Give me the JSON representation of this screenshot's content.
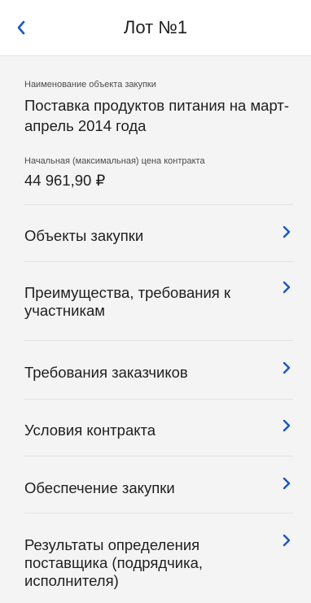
{
  "header": {
    "back_icon": "chevron-left-icon",
    "title": "Лот №1"
  },
  "info": {
    "object_label": "Наименование объекта закупки",
    "object_value": "Поставка продуктов питания на март-апрель 2014 года",
    "price_label": "Начальная (максимальная) цена контракта",
    "price_value": "44 961,90 ₽"
  },
  "menu": [
    {
      "label": "Объекты закупки"
    },
    {
      "label": "Преимущества, требования к участникам"
    },
    {
      "label": "Требования заказчиков"
    },
    {
      "label": "Условия контракта"
    },
    {
      "label": "Обеспечение закупки"
    },
    {
      "label": "Результаты определения поставщика (подрядчика, исполнителя)"
    }
  ],
  "colors": {
    "accent": "#1a56c4",
    "background": "#f4f4f4",
    "header_bg": "#ffffff"
  }
}
